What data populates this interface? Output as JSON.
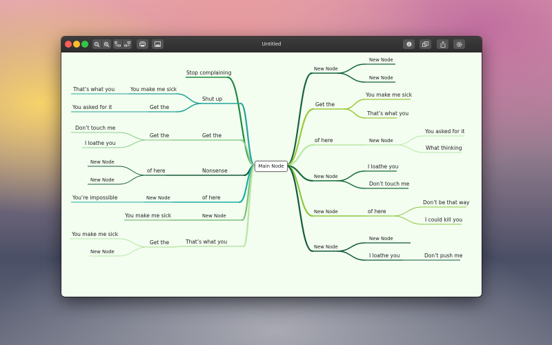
{
  "window": {
    "title": "Untitled"
  },
  "toolbar": {
    "icons": [
      "zoom-out-icon",
      "zoom-in-icon",
      "indent-left-icon",
      "indent-right-icon",
      "print-icon",
      "image-icon",
      "info-icon",
      "duplicate-icon",
      "share-icon",
      "settings-icon"
    ]
  },
  "mindmap": {
    "main": "Main Node",
    "left": [
      {
        "label": "Stop complaining",
        "color": "#1c8a3c",
        "children": []
      },
      {
        "label": "Shut up",
        "color": "#23a39a",
        "children": [
          {
            "label": "You make me sick",
            "children": [
              {
                "label": "That’s what you"
              }
            ]
          },
          {
            "label": "Get the",
            "children": [
              {
                "label": "You asked for it"
              }
            ]
          }
        ]
      },
      {
        "label": "Get the",
        "color": "#8fce8b",
        "children": [
          {
            "label": "Get the",
            "children": [
              {
                "label": "Don’t touch me"
              },
              {
                "label": "I loathe you"
              }
            ]
          }
        ]
      },
      {
        "label": "Nonsense",
        "color": "#135a3a",
        "children": [
          {
            "label": "of here",
            "children": [
              {
                "label": "New Node"
              },
              {
                "label": "New Node"
              }
            ]
          }
        ]
      },
      {
        "label": "of here",
        "color": "#18b0a4",
        "children": [
          {
            "label": "New Node",
            "children": [
              {
                "label": "You’re impossible"
              }
            ]
          }
        ]
      },
      {
        "label": "New Node",
        "color": "#7fc07a",
        "children": [
          {
            "label": "You make me sick"
          }
        ]
      },
      {
        "label": "That’s what you",
        "color": "#b6e6a6",
        "children": [
          {
            "label": "Get the",
            "children": [
              {
                "label": "You make me sick"
              },
              {
                "label": "New Node"
              }
            ]
          }
        ]
      }
    ],
    "right": [
      {
        "label": "New Node",
        "color": "#15633f",
        "children": [
          {
            "label": "New Node"
          },
          {
            "label": "New Node"
          }
        ]
      },
      {
        "label": "Get the",
        "color": "#9bc93a",
        "children": [
          {
            "label": "You make me sick"
          },
          {
            "label": "That’s what you"
          }
        ]
      },
      {
        "label": "of here",
        "color": "#b7e8a8",
        "children": [
          {
            "label": "New Node",
            "children": [
              {
                "label": "You asked for it"
              },
              {
                "label": "What  thinking"
              }
            ]
          }
        ]
      },
      {
        "label": "New Node",
        "color": "#156c3a",
        "children": [
          {
            "label": "I loathe you"
          },
          {
            "label": "Don’t touch me"
          }
        ]
      },
      {
        "label": "New Node",
        "color": "#8cc63f",
        "children": [
          {
            "label": "of here",
            "children": [
              {
                "label": "Don’t be that way"
              },
              {
                "label": "I could kill you"
              }
            ]
          }
        ]
      },
      {
        "label": "New Node",
        "color": "#0f5a3a",
        "children": [
          {
            "label": "New Node"
          },
          {
            "label": "I loathe you",
            "children": [
              {
                "label": "Don’t push me"
              }
            ]
          }
        ]
      }
    ]
  }
}
